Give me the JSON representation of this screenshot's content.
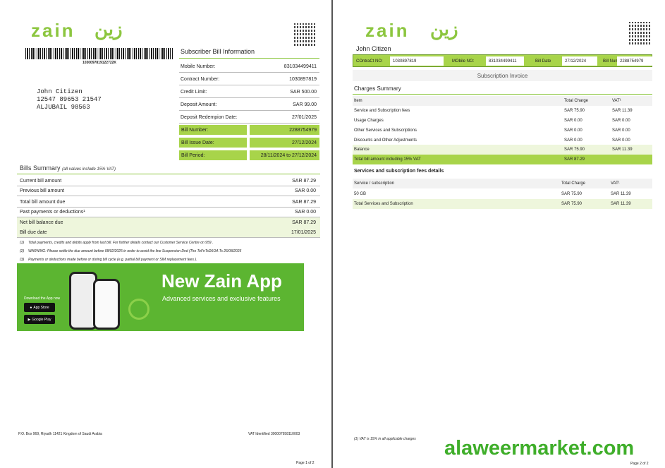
{
  "page1": {
    "logo_en": "zain",
    "logo_ar": "زين",
    "barcode_number": "1030097819122722K",
    "customer": {
      "name": "John Citizen",
      "address1": "12547  89653  21547",
      "address2": "ALJUBAIL  98563"
    },
    "subscriber": {
      "title": "Subscriber Bill Information",
      "rows": [
        {
          "label": "Mobile Number:",
          "value": "831034499411"
        },
        {
          "label": "Contract Number:",
          "value": "1030897819"
        },
        {
          "label": "Credit Limit:",
          "value": "SAR 500.00"
        },
        {
          "label": "Deposit Amount:",
          "value": "SAR 99.00"
        },
        {
          "label": "Deposit Redempion Date:",
          "value": "27/01/2025"
        }
      ],
      "highlight_rows": [
        {
          "label": "Bill Number:",
          "value": "2288754979"
        },
        {
          "label": "Bill Issue Date:",
          "value": "27/12/2024"
        },
        {
          "label": "Bill Period:",
          "value": "28/11/2024 to 27/12/2024"
        }
      ]
    },
    "bills_summary": {
      "title": "Bills Summary",
      "note": "(all values include 15% VAT)",
      "rows": [
        {
          "label": "Current bill amount",
          "value": "SAR 87.29"
        },
        {
          "label": "Previous bill amount",
          "value": "SAR 0.00"
        },
        {
          "label": "Total bill amount due",
          "value": "SAR 87.29"
        },
        {
          "label": "Past payments or deductions¹",
          "value": "SAR 0.00"
        },
        {
          "label": "Net bill balance due",
          "value": "SAR 87.29"
        },
        {
          "label": "Bill due date",
          "value": "17/01/2025"
        }
      ]
    },
    "footnotes": [
      {
        "num": "(1)",
        "text": "Total payments, credits and debits apply from last bill. For further details contact our Customer Service Centre on 959 ."
      },
      {
        "num": "(2)",
        "text": "WARNING: Please settle the due amount before  08/02/2025  in order to avoid the line Suspension Dnd (The TeFnTsD6OA Ts 26/08/2025"
      },
      {
        "num": "(3)",
        "text": "Payments or deductions made before or during bill cycle (e.g. partial bill payment or SIM replacement fees )."
      }
    ],
    "banner": {
      "title": "New Zain App",
      "subtitle": "Advanced services and exclusive features",
      "download_label": "Download the App now",
      "appstore": "App Store",
      "googleplay": "Google Play"
    },
    "footer_address": "P.O. Box 969, Riyadh 11421 Kingdom of Saudi Arabia",
    "footer_vat": "VAT Identified 300007958110003",
    "page_num": "Page 1 of 2"
  },
  "page2": {
    "logo_en": "zain",
    "logo_ar": "زين",
    "customer_name": "John Citizen",
    "header_cells": [
      {
        "label": "COntraCt NO:",
        "value": "1030897819"
      },
      {
        "label": "MObile NO:",
        "value": "831034499411"
      },
      {
        "label": "Bill Date",
        "value": "27/12/2024"
      },
      {
        "label": "Bill Number:",
        "value": "2288754979"
      }
    ],
    "invoice_title": "Subscription Invoice",
    "charges": {
      "title": "Charges Summary",
      "header": {
        "item": "Item",
        "total": "Total Charge",
        "vat": "VAT¹"
      },
      "rows": [
        {
          "item": "Service and Subscription fees",
          "total": "SAR 75.90",
          "vat": "SAR 11.39"
        },
        {
          "item": "Usage Charges",
          "total": "SAR 0.00",
          "vat": "SAR 0.00"
        },
        {
          "item": "Other Services and Subscriptions",
          "total": "SAR 0.00",
          "vat": "SAR 0.00"
        },
        {
          "item": "Discounts and Other Adjustments",
          "total": "SAR 0.00",
          "vat": "SAR 0.00"
        }
      ],
      "balance": {
        "item": "Balance",
        "total": "SAR 75.90",
        "vat": "SAR 11.39"
      },
      "total_row": {
        "item": "Total bill amount including 15% VAT",
        "total": "SAR 87.29"
      }
    },
    "details": {
      "title": "Services and subscription fees details",
      "header": {
        "item": "Service / subscription",
        "total": "Total Charge",
        "vat": "VAT¹"
      },
      "rows": [
        {
          "item": "50 GB",
          "total": "SAR 75.90",
          "vat": "SAR 11.39"
        }
      ],
      "total_row": {
        "item": "Total Services and Subscription",
        "total": "SAR 75.90",
        "vat": "SAR 11.39"
      }
    },
    "footnote": "(1) VAT is 15% in all applicable charges",
    "watermark": "alaweermarket.com",
    "page_num": "Page 2 of 2"
  }
}
